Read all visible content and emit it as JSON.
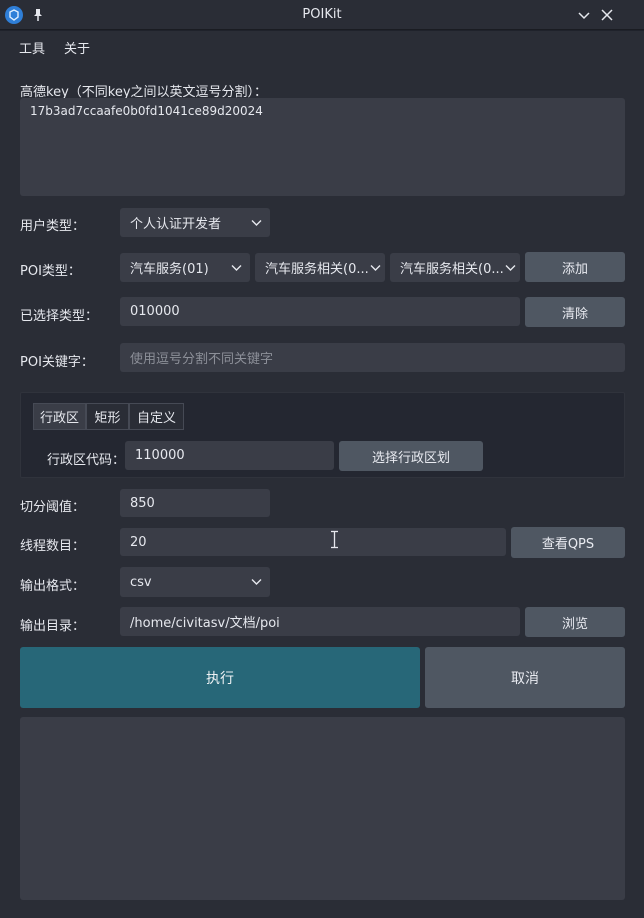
{
  "window": {
    "title": "POIKit"
  },
  "menu": {
    "tools": "工具",
    "about": "关于"
  },
  "key": {
    "label": "高德key（不同key之间以英文逗号分割）：",
    "value": "17b3ad7ccaafe0b0fd1041ce89d20024"
  },
  "user_type": {
    "label": "用户类型：",
    "value": "个人认证开发者"
  },
  "poi_type": {
    "label": "POI类型：",
    "level1": "汽车服务(01)",
    "level2": "汽车服务相关(0...",
    "level3": "汽车服务相关(0...",
    "add_label": "添加"
  },
  "selected_type": {
    "label": "已选择类型：",
    "value": "010000",
    "clear_label": "清除"
  },
  "keyword": {
    "label": "POI关键字：",
    "placeholder": "使用逗号分割不同关键字"
  },
  "tabs": {
    "admin": "行政区",
    "rect": "矩形",
    "custom": "自定义"
  },
  "admin_code": {
    "label": "行政区代码：",
    "value": "110000",
    "select_label": "选择行政区划"
  },
  "threshold": {
    "label": "切分阈值：",
    "value": "850"
  },
  "threads": {
    "label": "线程数目：",
    "value": "20",
    "qps_label": "查看QPS"
  },
  "output_format": {
    "label": "输出格式：",
    "value": "csv"
  },
  "output_dir": {
    "label": "输出目录：",
    "value": "/home/civitasv/文档/poi",
    "browse_label": "浏览"
  },
  "actions": {
    "run_label": "执行",
    "cancel_label": "取消"
  },
  "colors": {
    "primary": "#276778",
    "button": "#4f5762",
    "field": "#3a3d47",
    "background": "#2a2d36"
  }
}
